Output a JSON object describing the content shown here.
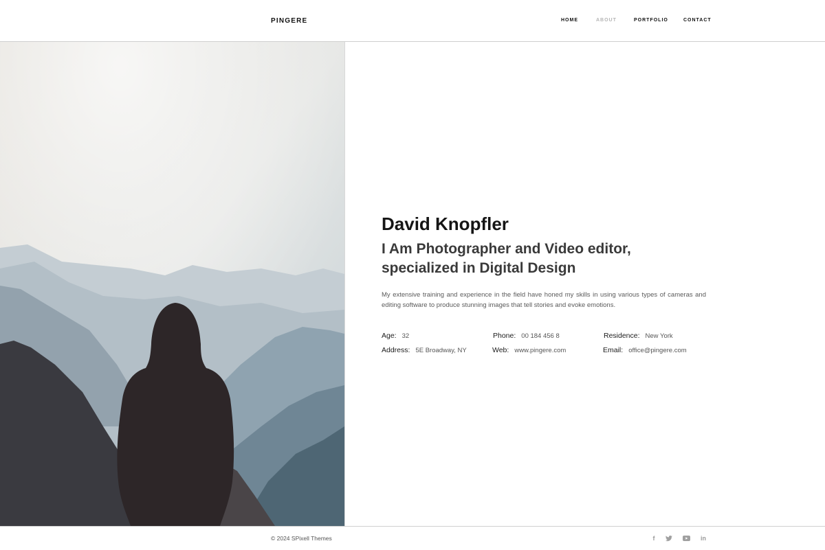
{
  "header": {
    "logo": "PINGERE",
    "nav": [
      {
        "label": "HOME",
        "active": false
      },
      {
        "label": "ABOUT",
        "active": true
      },
      {
        "label": "PORTFOLIO",
        "active": false
      },
      {
        "label": "CONTACT",
        "active": false
      }
    ]
  },
  "profile": {
    "name": "David Knopfler",
    "headline": "I Am Photographer and Video editor, specialized in Digital Design",
    "bio": "My extensive training and experience in the field have honed my skills in using various types of cameras and editing software to produce stunning images that tell stories and evoke emotions.",
    "details": {
      "age": {
        "label": "Age:",
        "value": "32"
      },
      "phone": {
        "label": "Phone:",
        "value": "00 184 456 8"
      },
      "residence": {
        "label": "Residence:",
        "value": "New York"
      },
      "address": {
        "label": "Address:",
        "value": "5E Broadway,  NY"
      },
      "web": {
        "label": "Web:",
        "value": "www.pingere.com"
      },
      "email": {
        "label": "Email:",
        "value": "office@pingere.com"
      }
    }
  },
  "footer": {
    "copyright": "© 2024 SPixell Themes",
    "social": [
      {
        "icon": "facebook-icon",
        "glyph": "f"
      },
      {
        "icon": "twitter-icon",
        "glyph": "t"
      },
      {
        "icon": "youtube-icon",
        "glyph": "▶"
      },
      {
        "icon": "linkedin-icon",
        "glyph": "in"
      }
    ]
  }
}
